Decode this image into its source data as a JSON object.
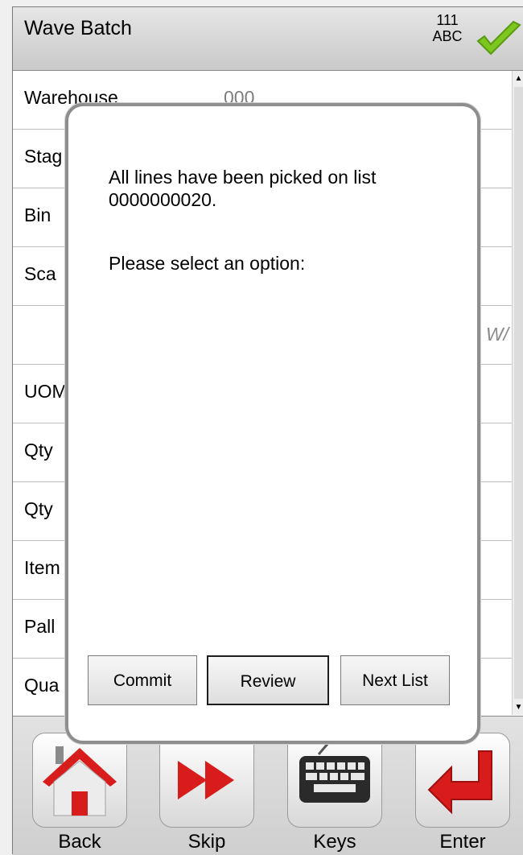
{
  "header": {
    "title": "Wave Batch",
    "status_top": "111",
    "status_bottom": "ABC",
    "confirm_icon": "check-icon"
  },
  "fields": [
    {
      "label": "Warehouse",
      "value": "000"
    },
    {
      "label": "Stag",
      "value": ""
    },
    {
      "label": "Bin",
      "value": ""
    },
    {
      "label": "Sca",
      "value": ""
    },
    {
      "label": "",
      "value": "",
      "hint": "W/"
    },
    {
      "label": "UOM",
      "value": ""
    },
    {
      "label": "Qty",
      "value": ""
    },
    {
      "label": "Qty",
      "value": ""
    },
    {
      "label": "Item",
      "value": ""
    },
    {
      "label": "Pall",
      "value": ""
    },
    {
      "label": "Qua",
      "value": ""
    }
  ],
  "dialog": {
    "message": "All lines have been picked on list 0000000020.",
    "prompt": "Please select an option:",
    "buttons": {
      "commit": "Commit",
      "review": "Review",
      "next": "Next List"
    }
  },
  "nav": {
    "back": "Back",
    "skip": "Skip",
    "keys": "Keys",
    "enter": "Enter"
  },
  "colors": {
    "accent_red": "#d81b1b",
    "check_green": "#7cc61e"
  }
}
